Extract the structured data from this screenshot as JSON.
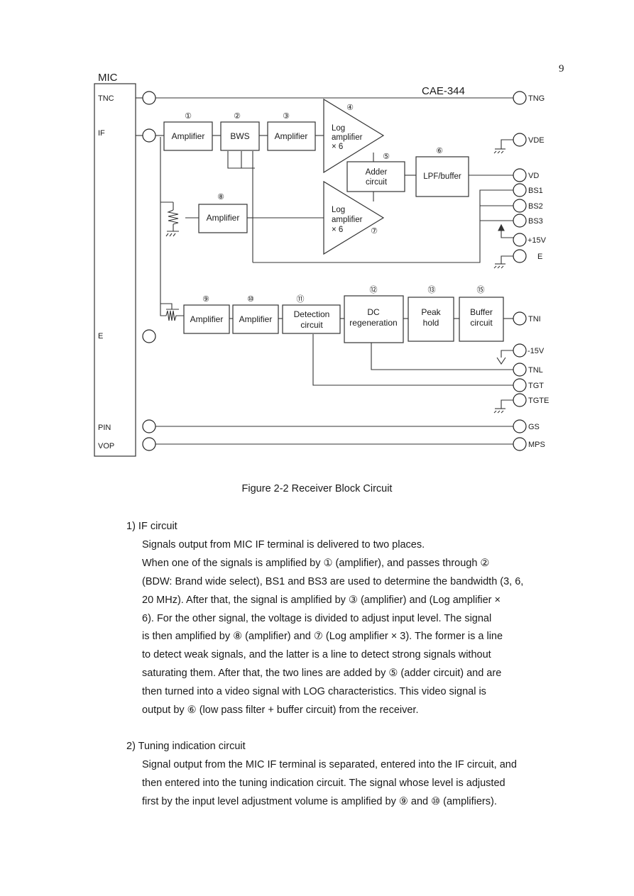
{
  "page_number": "9",
  "figure": {
    "caption": "Figure 2-2   Receiver Block Circuit",
    "mic_label": "MIC",
    "module_label": "CAE-344",
    "mic_terminals": [
      "TNC",
      "IF",
      "E",
      "PIN",
      "VOP"
    ],
    "blocks": [
      {
        "id": "1",
        "marker": "①",
        "lines": [
          "Amplifier"
        ]
      },
      {
        "id": "2",
        "marker": "②",
        "lines": [
          "BWS"
        ]
      },
      {
        "id": "3",
        "marker": "③",
        "lines": [
          "Amplifier"
        ]
      },
      {
        "id": "4",
        "marker": "④",
        "lines": [
          "Log",
          "amplifier",
          "× 6"
        ]
      },
      {
        "id": "5",
        "marker": "⑤",
        "lines": [
          "Adder",
          "circuit"
        ]
      },
      {
        "id": "6",
        "marker": "⑥",
        "lines": [
          "LPF/buffer"
        ]
      },
      {
        "id": "7",
        "marker": "⑦",
        "lines": [
          "Log",
          "amplifier",
          "× 6"
        ]
      },
      {
        "id": "8",
        "marker": "⑧",
        "lines": [
          "Amplifier"
        ]
      },
      {
        "id": "9",
        "marker": "⑨",
        "lines": [
          "Amplifier"
        ]
      },
      {
        "id": "10",
        "marker": "⑩",
        "lines": [
          "Amplifier"
        ]
      },
      {
        "id": "11",
        "marker": "⑪",
        "lines": [
          "Detection",
          "circuit"
        ]
      },
      {
        "id": "12",
        "marker": "⑫",
        "lines": [
          "DC",
          "regeneration"
        ]
      },
      {
        "id": "13",
        "marker": "⑬",
        "lines": [
          "Peak",
          "hold"
        ]
      },
      {
        "id": "15",
        "marker": "⑮",
        "lines": [
          "Buffer",
          "circuit"
        ]
      }
    ],
    "output_terminals": [
      "TNG",
      "VDE",
      "VD",
      "BS1",
      "BS2",
      "BS3",
      "+15V",
      "E",
      "TNI",
      "-15V",
      "TNL",
      "TGT",
      "TGTE",
      "GS",
      "MPS"
    ]
  },
  "sections": [
    {
      "heading": "1) IF circuit",
      "lines": [
        "Signals output from MIC IF terminal is delivered to two places.",
        "When one of the signals is amplified by ① (amplifier), and passes through ②",
        "(BDW: Brand wide select), BS1 and BS3 are used to determine the bandwidth (3, 6,",
        "20 MHz).   After that, the signal is amplified by ③ (amplifier) and (Log amplifier ×",
        "6).   For the other signal, the voltage is divided to adjust input level.   The signal",
        "is then amplified by ⑧ (amplifier) and ⑦ (Log amplifier × 3).   The former is a line",
        "to detect weak signals, and the latter is a line to detect strong signals without",
        "saturating them.   After that, the two lines are added by ⑤ (adder circuit) and are",
        "then turned into a video signal with LOG characteristics.   This video signal is",
        "output by ⑥ (low pass filter + buffer circuit) from the receiver."
      ]
    },
    {
      "heading": "2) Tuning indication circuit",
      "lines": [
        "Signal output from the MIC IF terminal is separated, entered into the IF circuit, and",
        "then entered into the tuning indication circuit.   The signal whose level is adjusted",
        "first by the input level adjustment volume is amplified by ⑨ and ⑩ (amplifiers)."
      ]
    }
  ]
}
